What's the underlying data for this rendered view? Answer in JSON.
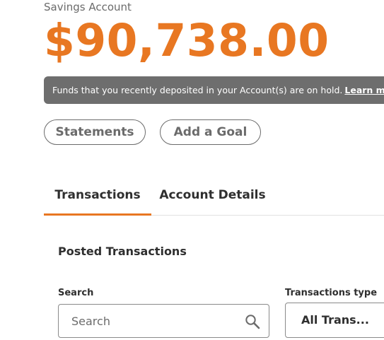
{
  "account": {
    "type_label": "Savings Account",
    "balance": "$90,738.00"
  },
  "hold_banner": {
    "message": "Funds that you recently deposited in your Account(s) are on hold.",
    "link_label": "Learn more"
  },
  "actions": {
    "statements_label": "Statements",
    "add_goal_label": "Add a Goal"
  },
  "tabs": [
    {
      "label": "Transactions",
      "active": true
    },
    {
      "label": "Account Details",
      "active": false
    }
  ],
  "transactions": {
    "section_title": "Posted Transactions",
    "search_label": "Search",
    "search_placeholder": "Search",
    "type_label": "Transactions type",
    "type_selected": "All Trans..."
  },
  "colors": {
    "accent": "#e87722",
    "banner_bg": "#6e6e6e",
    "text_muted": "#6b6b6b"
  },
  "icons": {
    "search": "search-icon"
  }
}
